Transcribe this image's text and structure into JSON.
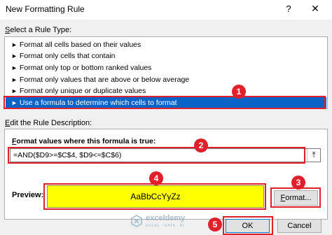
{
  "window": {
    "title": "New Formatting Rule",
    "help_label": "?",
    "close_label": "✕"
  },
  "rule_type": {
    "label_prefix": "S",
    "label_rest": "elect a Rule Type:",
    "items": [
      "Format all cells based on their values",
      "Format only cells that contain",
      "Format only top or bottom ranked values",
      "Format only values that are above or below average",
      "Format only unique or duplicate values",
      "Use a formula to determine which cells to format"
    ],
    "selected_index": 5,
    "bullet": "►"
  },
  "description": {
    "label_prefix": "E",
    "label_rest": "dit the Rule Description:",
    "formula_label_prefix": "F",
    "formula_label_rest": "ormat values where this formula is true:",
    "formula_value": "=AND($D9>=$C$4, $D9<=$C$6)",
    "collapse_icon": "⤒",
    "preview_label": "Preview:",
    "preview_sample": "AaBbCcYyZz",
    "format_button_prefix": "F",
    "format_button_rest": "ormat..."
  },
  "buttons": {
    "ok": "OK",
    "cancel": "Cancel"
  },
  "annotations": [
    "1",
    "2",
    "3",
    "4",
    "5"
  ],
  "watermark": {
    "name": "exceldemy",
    "tagline": "EXCEL · DATA · BI"
  },
  "colors": {
    "selection": "#0a64c8",
    "annotation_red": "#e0202a",
    "preview_fill": "#ffff00"
  }
}
